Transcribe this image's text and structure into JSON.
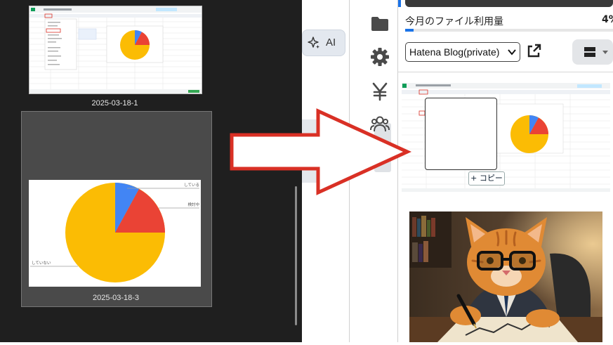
{
  "left_panel": {
    "thumbnails": [
      {
        "caption": "2025-03-18-1",
        "selected": false
      },
      {
        "caption": "2025-03-18-3",
        "selected": true
      }
    ],
    "pie_labels": {
      "top_right": "している",
      "middle_right": "検討中",
      "bottom_left": "していない"
    }
  },
  "middle": {
    "ai_button_label": "AI",
    "ai_icon": "sparkle-icon"
  },
  "icon_rail": {
    "icons": [
      "folder-icon",
      "gear-icon",
      "yen-icon",
      "users-icon"
    ]
  },
  "right_panel": {
    "usage_label": "今月のファイル利用量",
    "usage_percent_text": "4%",
    "usage_fraction": 0.04,
    "blog_select_value": "Hatena Blog(private)",
    "external_link_icon": "external-link-icon",
    "layout_button_icon": "layout-icon",
    "copy_button_label": "+ コピー"
  },
  "colors": {
    "accent": "#1a73e8",
    "pie_yellow": "#fbbc04",
    "pie_red": "#ea4335",
    "pie_blue": "#4285f4",
    "arrow_red": "#d93025"
  }
}
